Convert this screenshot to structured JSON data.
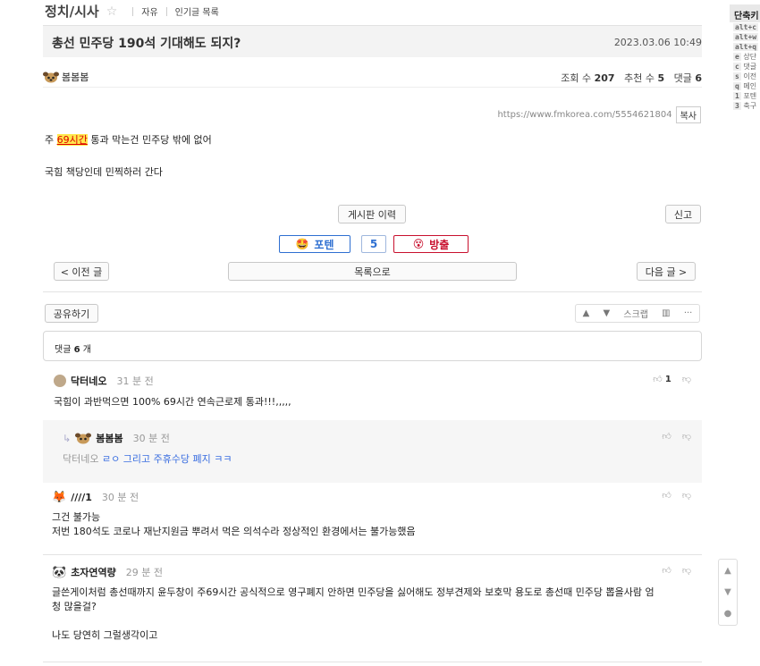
{
  "board": {
    "title": "정치/시사",
    "tabs": [
      "자유",
      "인기글 목록"
    ]
  },
  "post": {
    "title": "총선 민주당 190석 기대해도 되지?",
    "date": "2023.03.06 10:49",
    "author": "봄봄봄",
    "views_label": "조회 수",
    "views": "207",
    "recommend_label": "추천 수",
    "recommend": "5",
    "comments_label": "댓글",
    "comments": "6",
    "url": "https://www.fmkorea.com/5554621804",
    "copy_label": "복사",
    "body_line1_prefix": "주 ",
    "body_line1_highlight": "69시간",
    "body_line1_suffix": " 통과 막는건 민주당 밖에 없어",
    "body_line2": "국힘 책당인데 민찍하러 간다"
  },
  "actions": {
    "history": "게시판 이력",
    "report": "신고",
    "upvote": "포텐",
    "vote_count": "5",
    "downvote": "방출",
    "prev": "< 이전 글",
    "list": "목록으로",
    "next": "다음 글 >",
    "share": "공유하기",
    "scrap": "스크랩",
    "more": "···"
  },
  "comment_summary": {
    "label": "댓글",
    "count": "6",
    "unit": "개"
  },
  "comments": [
    {
      "name": "닥터네오",
      "time": "31 분 전",
      "likes": "1",
      "text": "국힘이 과반먹으면 100% 69시간 연속근로제 통과!!!,,,,,"
    },
    {
      "name": "봄봄봄",
      "time": "30 분 전",
      "likes": "",
      "mention": "닥터네오",
      "text": "ㄹㅇ 그리고 주휴수당 폐지 ㅋㅋ"
    },
    {
      "name": "////1",
      "time": "30 분 전",
      "likes": "",
      "text1": "그건 불가능",
      "text2": "저번 180석도 코로나 재난지원금 뿌려서 먹은 의석수라 정상적인 환경에서는 불가능했음"
    },
    {
      "name": "초자연역량",
      "time": "29 분 전",
      "likes": "",
      "text1": "글쓴게이처럼 총선때까지 윤두창이 주69시간 공식적으로 영구폐지 안하면 민주당을 싫어해도 정부견제와 보호막 용도로 총선때 민주당 뽑을사람 엄",
      "text1b": "청 많을걸?",
      "text2": "나도 당연히 그럴생각이고"
    }
  ],
  "shortcuts": {
    "title": "단축키",
    "items": [
      {
        "key": "alt+c",
        "label": ""
      },
      {
        "key": "alt+w",
        "label": ""
      },
      {
        "key": "alt+q",
        "label": ""
      },
      {
        "key": "e",
        "label": "상단"
      },
      {
        "key": "c",
        "label": "댓글"
      },
      {
        "key": "s",
        "label": "이전"
      },
      {
        "key": "q",
        "label": "메인"
      },
      {
        "key": "1",
        "label": "포텐"
      },
      {
        "key": "3",
        "label": "축구"
      }
    ]
  },
  "colors": {
    "upvote": "#2e6fd1",
    "downvote": "#c8102e",
    "link": "#3a6ee0",
    "highlight": "#ffe84d"
  }
}
